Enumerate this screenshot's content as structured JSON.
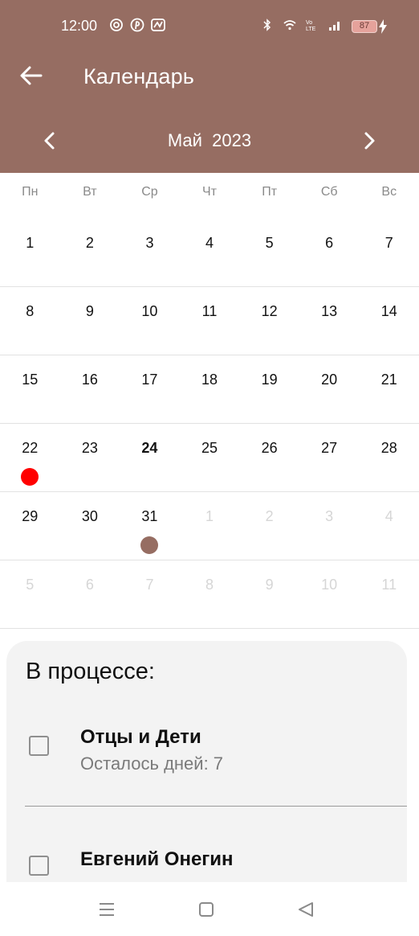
{
  "status_bar": {
    "time": "12:00",
    "battery": "87",
    "icons_left": [
      "at-icon",
      "pinterest-icon",
      "notification-icon"
    ],
    "icons_right": [
      "bluetooth-icon",
      "wifi-icon",
      "volte-icon",
      "signal-icon",
      "battery-icon",
      "charging-icon"
    ]
  },
  "header": {
    "title": "Календарь",
    "back_icon": "arrow-left-icon",
    "month_label": "Май  2023",
    "prev_icon": "chevron-left-icon",
    "next_icon": "chevron-right-icon",
    "bg_color": "#966d62"
  },
  "calendar": {
    "weekdays": [
      "Пн",
      "Вт",
      "Ср",
      "Чт",
      "Пт",
      "Сб",
      "Вс"
    ],
    "weeks": [
      [
        "1",
        "2",
        "3",
        "4",
        "5",
        "6",
        "7"
      ],
      [
        "8",
        "9",
        "10",
        "11",
        "12",
        "13",
        "14"
      ],
      [
        "15",
        "16",
        "17",
        "18",
        "19",
        "20",
        "21"
      ],
      [
        "22",
        "23",
        "24",
        "25",
        "26",
        "27",
        "28"
      ],
      [
        "29",
        "30",
        "31",
        "1",
        "2",
        "3",
        "4"
      ],
      [
        "5",
        "6",
        "7",
        "8",
        "9",
        "10",
        "11"
      ]
    ],
    "muted": [
      [
        4,
        3
      ],
      [
        4,
        4
      ],
      [
        4,
        5
      ],
      [
        4,
        6
      ],
      [
        5,
        0
      ],
      [
        5,
        1
      ],
      [
        5,
        2
      ],
      [
        5,
        3
      ],
      [
        5,
        4
      ],
      [
        5,
        5
      ],
      [
        5,
        6
      ]
    ],
    "today": [
      3,
      2
    ],
    "markers": [
      {
        "week": 3,
        "day": 0,
        "color": "#ff0000"
      },
      {
        "week": 4,
        "day": 2,
        "color": "#966d62"
      }
    ]
  },
  "panel": {
    "title": "В процессе:",
    "tasks": [
      {
        "title": "Отцы и Дети",
        "subtitle": "Осталось дней: 7",
        "subtitle_color": "#7a7a7a"
      },
      {
        "title": "Евгений Онегин",
        "subtitle": "",
        "subtitle_color": "#e53935"
      }
    ]
  },
  "navbar": {
    "icons": [
      "menu-icon",
      "home-icon",
      "back-triangle-icon"
    ]
  }
}
